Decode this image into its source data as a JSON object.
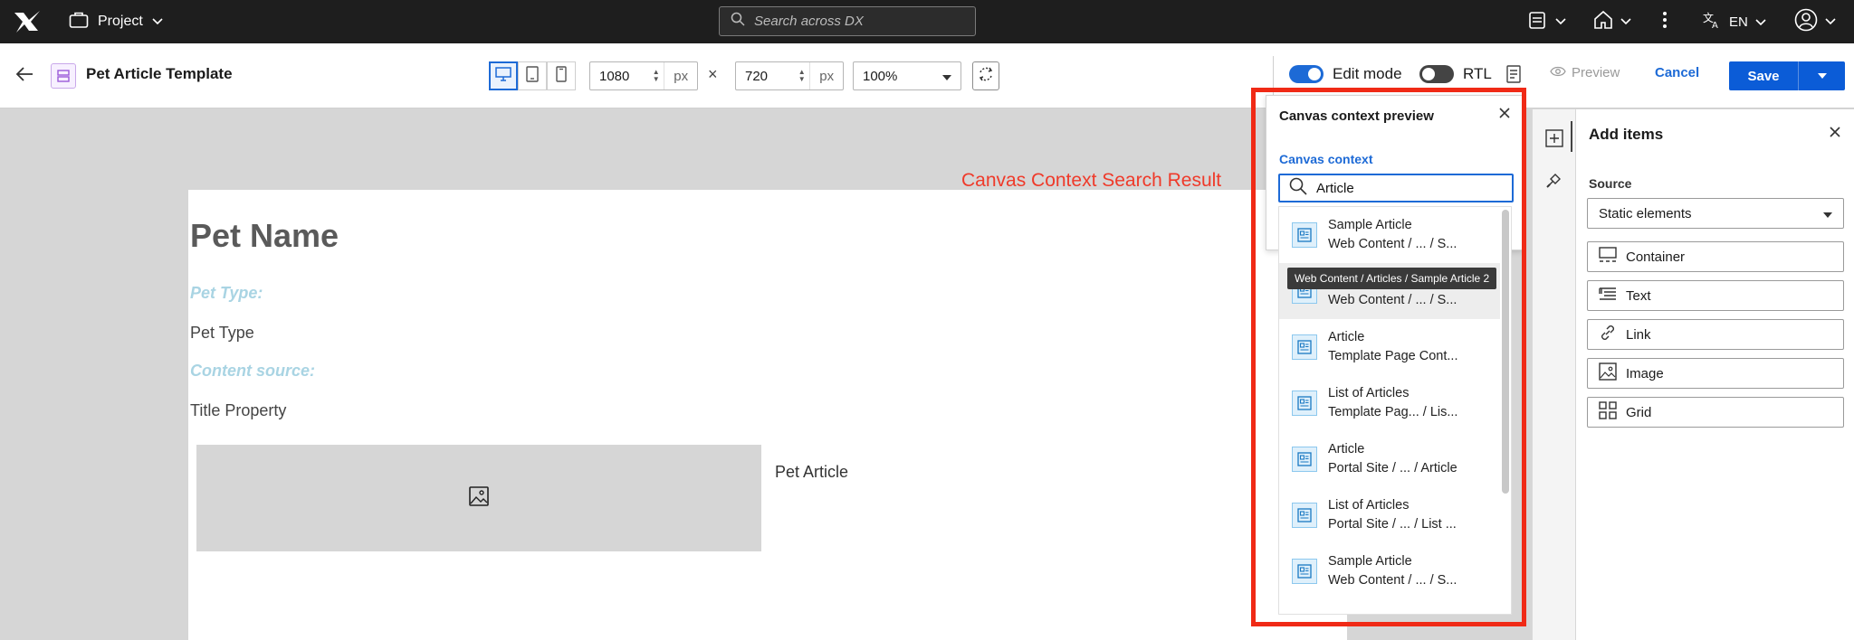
{
  "topbar": {
    "project_label": "Project",
    "search_placeholder": "Search across DX",
    "language": "EN"
  },
  "toolbar": {
    "page_title": "Pet Article Template",
    "width_value": "1080",
    "height_value": "720",
    "unit": "px",
    "times": "×",
    "zoom": "100%",
    "edit_mode_label": "Edit mode",
    "rtl_label": "RTL",
    "preview_label": "Preview",
    "cancel_label": "Cancel",
    "save_label": "Save"
  },
  "canvas": {
    "pet_name": "Pet Name",
    "pet_type_label": "Pet Type:",
    "pet_type": "Pet Type",
    "content_source_label": "Content source:",
    "title_property": "Title Property",
    "pet_article": "Pet Article"
  },
  "annotation": "Canvas Context Search Result",
  "popover": {
    "title": "Canvas context preview",
    "subtitle": "Canvas context",
    "search_value": "Article",
    "tooltip": "Web Content / Articles / Sample Article 2",
    "results": [
      {
        "title": "Sample Article",
        "path": "Web Content / ... / S..."
      },
      {
        "title": "",
        "path": "Web Content / ... / S..."
      },
      {
        "title": "Article",
        "path": "Template Page Cont..."
      },
      {
        "title": "List of Articles",
        "path": "Template Pag... / Lis..."
      },
      {
        "title": "Article",
        "path": "Portal Site / ... / Article"
      },
      {
        "title": "List of Articles",
        "path": "Portal Site / ... / List ..."
      },
      {
        "title": "Sample Article",
        "path": "Web Content / ... / S..."
      }
    ]
  },
  "add_items": {
    "title": "Add items",
    "source_label": "Source",
    "source_value": "Static elements",
    "items": [
      {
        "label": "Container",
        "icon": "container-icon"
      },
      {
        "label": "Text",
        "icon": "text-icon"
      },
      {
        "label": "Link",
        "icon": "link-icon"
      },
      {
        "label": "Image",
        "icon": "image-icon"
      },
      {
        "label": "Grid",
        "icon": "grid-icon"
      }
    ]
  },
  "colors": {
    "accent": "#1d6ad6",
    "annotation_red": "#f02a16",
    "topbar_bg": "#1e1e1e"
  }
}
